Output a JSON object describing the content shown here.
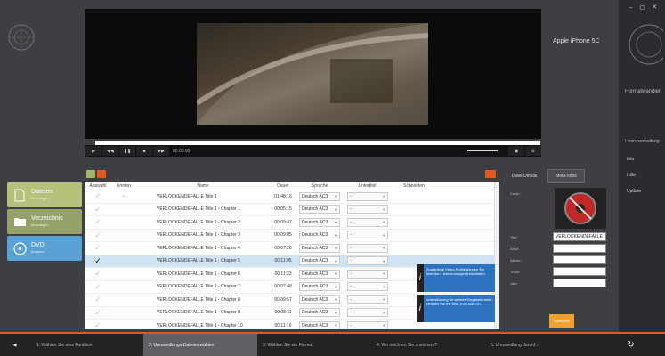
{
  "left_nav": {
    "files": {
      "title": "Dateien",
      "sub": "hinzufügen..."
    },
    "folder": {
      "title": "Verzeichnis",
      "sub": "hinzufügen..."
    },
    "dvd": {
      "title": "DVD",
      "sub": "auswon..."
    }
  },
  "player": {
    "time": "00:00:00",
    "device": "Apple iPhone 5C"
  },
  "right_bar": {
    "window_controls": "– ◻ ✕",
    "brand": "Formatwandler 8",
    "license": "Lizenzverwaltung",
    "menu": [
      "Info",
      "Hilfe",
      "Update"
    ]
  },
  "table": {
    "headers": {
      "select": "Auswahl",
      "knoten": "Knoten",
      "name": "Name",
      "dur": "Dauer",
      "lang": "Sprache",
      "sub": "Untertitel",
      "cut": "Schneiden"
    },
    "rows": [
      {
        "check": "✓",
        "knoten": "-",
        "name": "VERLOCKENDEFALLE Title 1",
        "dur": "01:48:16",
        "lang": "Deutsch AC3",
        "sub": "-"
      },
      {
        "check": "✓",
        "knoten": "",
        "name": "VERLOCKENDEFALLE Title 1 - Chapter 1",
        "dur": "00:05:15",
        "lang": "Deutsch AC3",
        "sub": "-"
      },
      {
        "check": "✓",
        "knoten": "",
        "name": "VERLOCKENDEFALLE Title 1 - Chapter 2",
        "dur": "00:09:47",
        "lang": "Deutsch AC3",
        "sub": "-"
      },
      {
        "check": "✓",
        "knoten": "",
        "name": "VERLOCKENDEFALLE Title 1 - Chapter 3",
        "dur": "00:09:05",
        "lang": "Deutsch AC3",
        "sub": "-"
      },
      {
        "check": "✓",
        "knoten": "",
        "name": "VERLOCKENDEFALLE Title 1 - Chapter 4",
        "dur": "00:07:20",
        "lang": "Deutsch AC3",
        "sub": "-"
      },
      {
        "check": "✓",
        "knoten": "",
        "name": "VERLOCKENDEFALLE Title 1 - Chapter 5",
        "dur": "00:11:05",
        "lang": "Deutsch AC3",
        "sub": "-",
        "selected": true
      },
      {
        "check": "✓",
        "knoten": "",
        "name": "VERLOCKENDEFALLE Title 1 - Chapter 6",
        "dur": "00:11:23",
        "lang": "Deutsch AC3",
        "sub": "-"
      },
      {
        "check": "✓",
        "knoten": "",
        "name": "VERLOCKENDEFALLE Title 1 - Chapter 7",
        "dur": "00:07:48",
        "lang": "Deutsch AC3",
        "sub": "-"
      },
      {
        "check": "✓",
        "knoten": "",
        "name": "VERLOCKENDEFALLE Title 1 - Chapter 8",
        "dur": "00:09:57",
        "lang": "Deutsch AC3",
        "sub": "-"
      },
      {
        "check": "✓",
        "knoten": "",
        "name": "VERLOCKENDEFALLE Title 1 - Chapter 9",
        "dur": "00:08:11",
        "lang": "Deutsch AC3",
        "sub": "-"
      },
      {
        "check": "✓",
        "knoten": "",
        "name": "VERLOCKENDEFALLE Title 1 - Chapter 10",
        "dur": "00:11:16",
        "lang": "Deutsch AC3",
        "sub": "-"
      }
    ]
  },
  "tips": [
    "Zusätzliche Video-Profile können Sie über den Lizenzmanager freischalten",
    "Unterstützung für weitere Eingabeformate erhalten Sie mit dem DVD Add-On"
  ],
  "meta": {
    "tabs": [
      "Datei-Details",
      "Meta-Infos"
    ],
    "cover_label": "Cover:",
    "fields": [
      {
        "label": "Titel:",
        "value": "VERLOCKENDEFALLE"
      },
      {
        "label": "Artist:",
        "value": ""
      },
      {
        "label": "Album:",
        "value": ""
      },
      {
        "label": "Track:",
        "value": ""
      },
      {
        "label": "Jahr:",
        "value": ""
      }
    ],
    "save": "Speichern"
  },
  "steps": [
    "1. Wählen Sie eine Funktion",
    "2. Umwandlungs-Dateien wählen",
    "3. Wählen Sie ein Format",
    "4. Wo möchten Sie speichern?",
    "5. Umwandlung durchf..."
  ]
}
